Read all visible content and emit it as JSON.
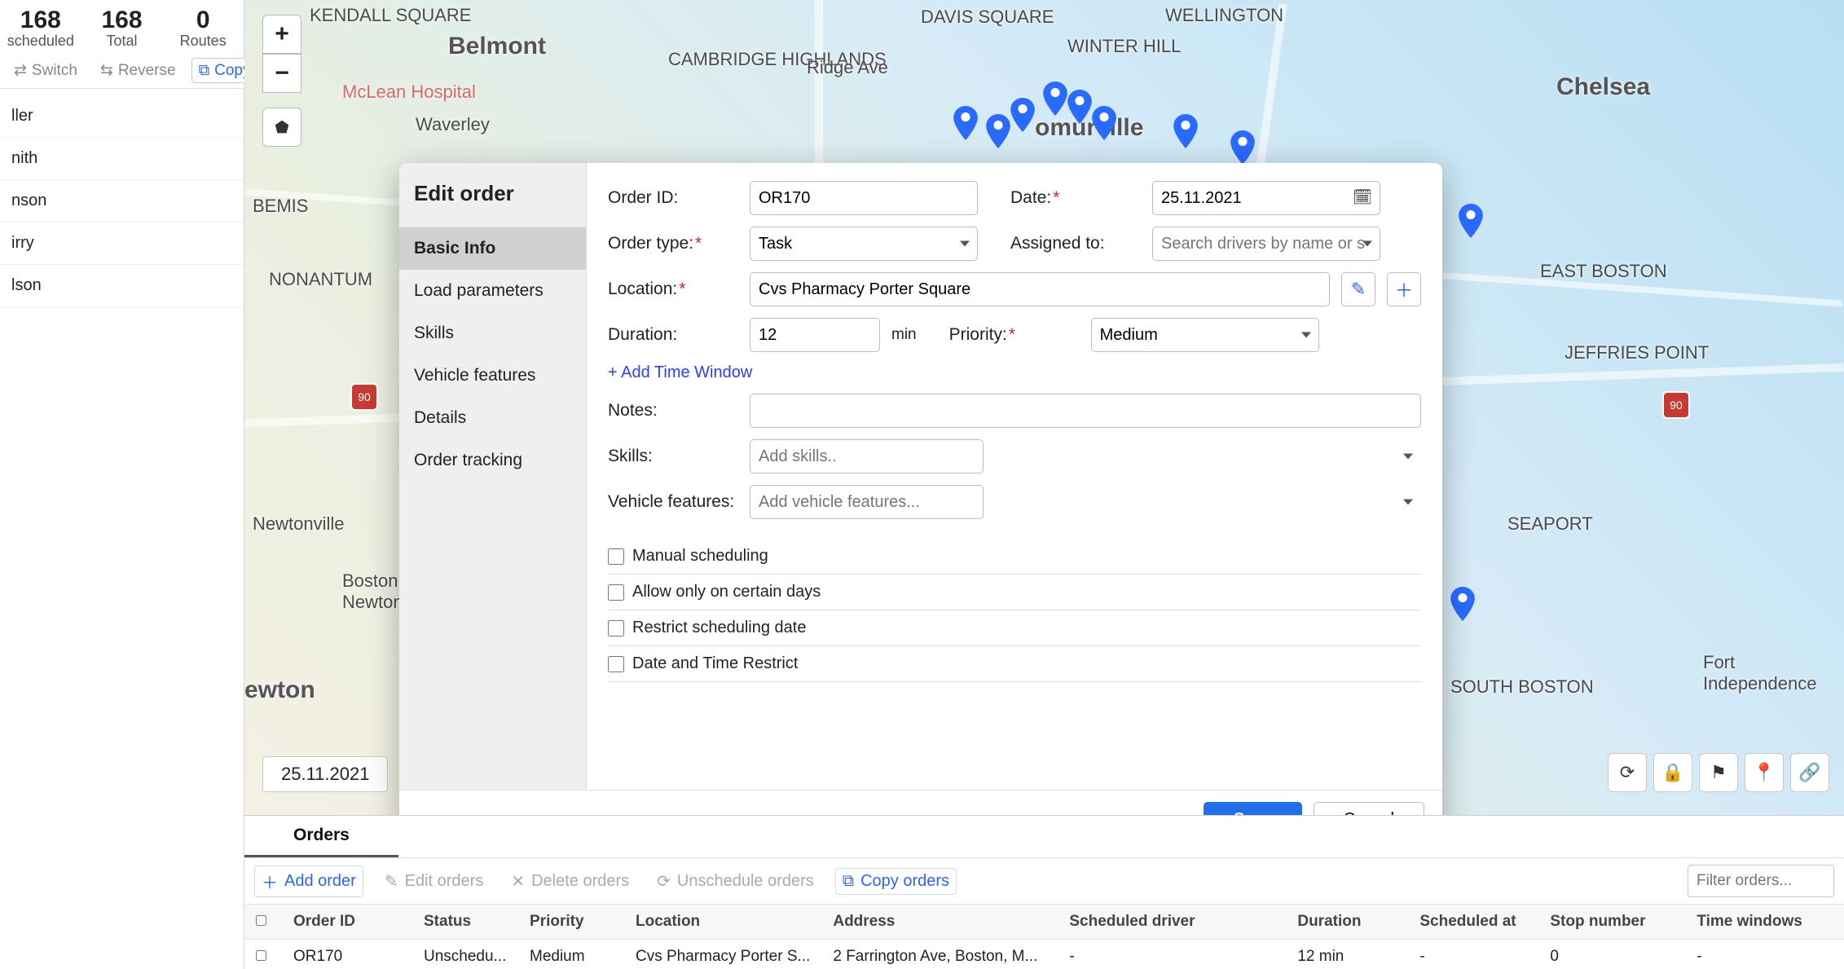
{
  "side": {
    "stats": [
      {
        "num": "168",
        "label": "scheduled"
      },
      {
        "num": "168",
        "label": "Total"
      },
      {
        "num": "0",
        "label": "Routes"
      }
    ],
    "tools": {
      "switch": "Switch",
      "reverse": "Reverse",
      "copy": "Copy"
    },
    "list": [
      "ller",
      "nith",
      "nson",
      "irry",
      "lson"
    ]
  },
  "map": {
    "labels": {
      "belmont": "Belmont",
      "cambridge": "CAMBRIDGE HIGHLANDS",
      "kendall": "KENDALL SQUARE",
      "wellington": "WELLINGTON",
      "davis": "DAVIS SQUARE",
      "winterhill": "WINTER HILL",
      "somerville": "omurville",
      "chelsea": "Chelsea",
      "eastboston": "EAST BOSTON",
      "jeffries": "JEFFRIES POINT",
      "seaport": "SEAPORT",
      "southboston": "SOUTH BOSTON",
      "fortind": "Fort Independence",
      "nonantum": "NONANTUM",
      "newtonville": "Newtonville",
      "newton": "ewton",
      "newtoncentre": "Newton Centre",
      "bostoncoll": "Boston Colle... Newton Car",
      "waverley": "Waverley",
      "mclean": "McLean Hospital",
      "bemis": "BEMIS",
      "ridge": "Ridge Ave"
    },
    "date": "25.11.2021"
  },
  "modal": {
    "title": "Edit order",
    "tabs": [
      "Basic Info",
      "Load parameters",
      "Skills",
      "Vehicle features",
      "Details",
      "Order tracking"
    ],
    "fields": {
      "order_id_label": "Order ID:",
      "order_id": "OR170",
      "date_label": "Date:",
      "date": "25.11.2021",
      "order_type_label": "Order type:",
      "order_type": "Task",
      "assigned_label": "Assigned to:",
      "assigned_placeholder": "Search drivers by name or s",
      "location_label": "Location:",
      "location": "Cvs Pharmacy Porter Square",
      "duration_label": "Duration:",
      "duration": "12",
      "duration_unit": "min",
      "priority_label": "Priority:",
      "priority": "Medium",
      "add_tw": "+ Add Time Window",
      "notes_label": "Notes:",
      "skills_label": "Skills:",
      "skills_placeholder": "Add skills..",
      "vf_label": "Vehicle features:",
      "vf_placeholder": "Add vehicle features..."
    },
    "checks": [
      "Manual scheduling",
      "Allow only on certain days",
      "Restrict scheduling date",
      "Date and Time Restrict"
    ],
    "buttons": {
      "save": "Save",
      "cancel": "Cancel"
    }
  },
  "bottom": {
    "tabs": {
      "orders": "Orders"
    },
    "actions": {
      "add": "Add order",
      "edit": "Edit orders",
      "delete": "Delete orders",
      "unschedule": "Unschedule orders",
      "copy": "Copy orders",
      "filter_placeholder": "Filter orders..."
    },
    "columns": [
      "Order ID",
      "Status",
      "Priority",
      "Location",
      "Address",
      "Scheduled driver",
      "Duration",
      "Scheduled at",
      "Stop number",
      "Time windows"
    ],
    "rows": [
      {
        "id": "OR170",
        "status": "Unschedu...",
        "priority": "Medium",
        "location": "Cvs Pharmacy Porter S...",
        "address": "2 Farrington Ave, Boston, M...",
        "driver": "-",
        "duration": "12 min",
        "scheduled_at": "-",
        "stop": "0",
        "tw": "-"
      }
    ]
  }
}
